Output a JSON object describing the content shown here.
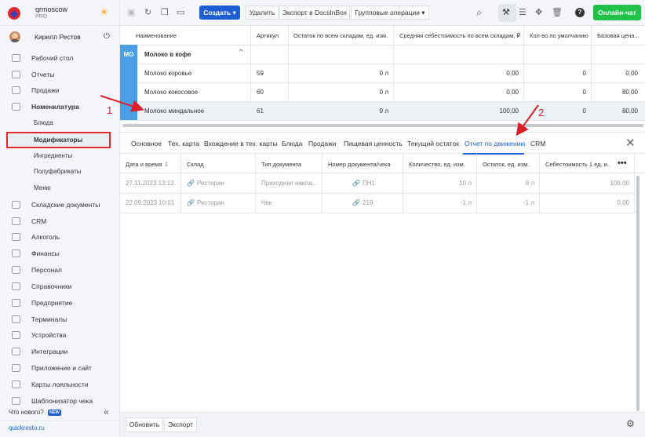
{
  "brand": {
    "name": "qrmoscow",
    "plan": "PRO"
  },
  "user": {
    "name": "Кирилл Рестов"
  },
  "sidebar": {
    "items": [
      "Рабочий стол",
      "Отчеты",
      "Продажи",
      "Номенклатура"
    ],
    "sub_items": [
      "Блюда",
      "Модификаторы",
      "Ингредиенты",
      "Полуфабрикаты",
      "Меню"
    ],
    "items2": [
      "Складские документы",
      "CRM",
      "Алкоголь",
      "Финансы",
      "Персонал",
      "Справочники",
      "Предприятие",
      "Терминалы",
      "Устройства",
      "Интеграции",
      "Приложение и сайт",
      "Карты лояльности",
      "Шаблонизатор чека"
    ],
    "whats_new": "Что нового?",
    "new_badge": "NEW",
    "footer_link": "quickresto.ru"
  },
  "toolbar": {
    "create": "Создать",
    "delete": "Удалить",
    "export_docsinbox": "Экспорт в DocsInBox",
    "group_ops": "Групповые операции",
    "chat": "Онлайн-чат"
  },
  "upper_table": {
    "headers": [
      "Наименование",
      "Артикул",
      "Остаток по всем складам, ед. изм.",
      "Средняя себестоимость по всем складам, ₽",
      "Кол-во по умолчанию",
      "Базовая цена..."
    ],
    "group": {
      "badge": "МО",
      "name": "Молоко в кофе"
    },
    "rows": [
      [
        "Молоко коровье",
        "59",
        "0 л",
        "0,00",
        "0",
        "0,00"
      ],
      [
        "Молоко кокосовое",
        "60",
        "0 л",
        "0,00",
        "0",
        "80,00"
      ],
      [
        "Молоко миндальное",
        "61",
        "9 л",
        "100,00",
        "0",
        "80,00"
      ]
    ]
  },
  "tabs": [
    "Основное",
    "Тех. карта",
    "Вхождение в тех. карты",
    "Блюда",
    "Продажи",
    "Пищевая ценность",
    "Текущий остаток",
    "Отчет по движению",
    "CRM"
  ],
  "movement_table": {
    "headers": [
      "Дата и время",
      "Склад",
      "Тип документа",
      "Номер документа/чека",
      "Количество, ед. изм.",
      "Остаток, ед. изм.",
      "Себестоимость 1 ед. и..."
    ],
    "rows": [
      [
        "27.11.2023 13:12",
        "Ресторан",
        "Приходная накла...",
        "ПН1",
        "10 л",
        "9 л",
        "100,00"
      ],
      [
        "22.09.2023 10:01",
        "Ресторан",
        "Чек",
        "219",
        "-1 л",
        "-1 л",
        "0,00"
      ]
    ]
  },
  "bottom": {
    "refresh": "Обновить",
    "export": "Экспорт"
  },
  "annotations": [
    "1",
    "2"
  ],
  "colors": {
    "accent": "#1d5fd3",
    "chat": "#21c14a",
    "annotation": "#d9202a",
    "group": "#4a9fe6"
  }
}
